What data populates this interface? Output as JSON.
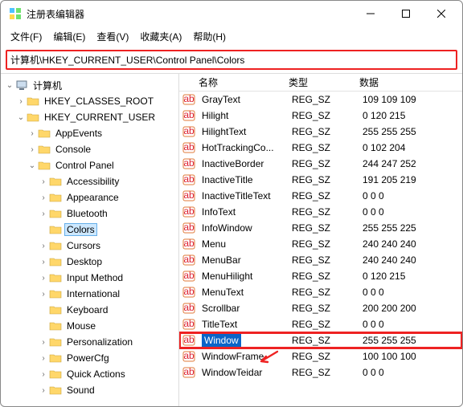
{
  "window": {
    "title": "注册表编辑器"
  },
  "menus": {
    "file": "文件(F)",
    "edit": "编辑(E)",
    "view": "查看(V)",
    "favorites": "收藏夹(A)",
    "help": "帮助(H)"
  },
  "address": "计算机\\HKEY_CURRENT_USER\\Control Panel\\Colors",
  "tree": {
    "root": "计算机",
    "hkcr": "HKEY_CLASSES_ROOT",
    "hkcu": "HKEY_CURRENT_USER",
    "items": {
      "appevents": "AppEvents",
      "console": "Console",
      "controlpanel": "Control Panel",
      "cp": {
        "accessibility": "Accessibility",
        "appearance": "Appearance",
        "bluetooth": "Bluetooth",
        "colors": "Colors",
        "cursors": "Cursors",
        "desktop": "Desktop",
        "inputmethod": "Input Method",
        "international": "International",
        "keyboard": "Keyboard",
        "mouse": "Mouse",
        "personalization": "Personalization",
        "powercfg": "PowerCfg",
        "quickactions": "Quick Actions",
        "sound": "Sound"
      }
    }
  },
  "columns": {
    "name": "名称",
    "type": "类型",
    "data": "数据"
  },
  "values": [
    {
      "name": "GrayText",
      "type": "REG_SZ",
      "data": "109 109 109"
    },
    {
      "name": "Hilight",
      "type": "REG_SZ",
      "data": "0 120 215"
    },
    {
      "name": "HilightText",
      "type": "REG_SZ",
      "data": "255 255 255"
    },
    {
      "name": "HotTrackingCo...",
      "type": "REG_SZ",
      "data": "0 102 204"
    },
    {
      "name": "InactiveBorder",
      "type": "REG_SZ",
      "data": "244 247 252"
    },
    {
      "name": "InactiveTitle",
      "type": "REG_SZ",
      "data": "191 205 219"
    },
    {
      "name": "InactiveTitleText",
      "type": "REG_SZ",
      "data": "0 0 0"
    },
    {
      "name": "InfoText",
      "type": "REG_SZ",
      "data": "0 0 0"
    },
    {
      "name": "InfoWindow",
      "type": "REG_SZ",
      "data": "255 255 225"
    },
    {
      "name": "Menu",
      "type": "REG_SZ",
      "data": "240 240 240"
    },
    {
      "name": "MenuBar",
      "type": "REG_SZ",
      "data": "240 240 240"
    },
    {
      "name": "MenuHilight",
      "type": "REG_SZ",
      "data": "0 120 215"
    },
    {
      "name": "MenuText",
      "type": "REG_SZ",
      "data": "0 0 0"
    },
    {
      "name": "Scrollbar",
      "type": "REG_SZ",
      "data": "200 200 200"
    },
    {
      "name": "TitleText",
      "type": "REG_SZ",
      "data": "0 0 0"
    },
    {
      "name": "Window",
      "type": "REG_SZ",
      "data": "255 255 255",
      "selected": true,
      "highlighted": true
    },
    {
      "name": "WindowFrame",
      "type": "REG_SZ",
      "data": "100 100 100",
      "arrow": true
    },
    {
      "name": "WindowTeidar",
      "type": "REG_SZ",
      "data": "0 0 0"
    }
  ]
}
